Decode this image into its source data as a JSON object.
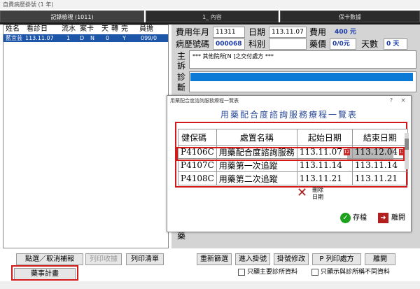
{
  "window": {
    "title": "自費病歷掛號 (1 年)"
  },
  "tabs": [
    {
      "label": "記錄檢視 (1011)"
    },
    {
      "label": "1_ 內容"
    },
    {
      "label": "保卡數據"
    }
  ],
  "left_list": {
    "headers": [
      "姓名",
      "看診日",
      "流水",
      "案卡",
      "天",
      "轉",
      "完",
      "員擔"
    ],
    "selected_row": {
      "name": "藍宜芸",
      "date": "113.11.07",
      "serial": "1",
      "card": "D",
      "case": "N",
      "days": "0",
      "flag": "Y",
      "doc": "099/0"
    }
  },
  "form": {
    "fee_month_label": "費用年月",
    "fee_month": "11311",
    "date_label": "日期",
    "date": "113.11.07",
    "fee_label": "費用",
    "fee_value": "400 元",
    "chart_label": "病歷號碼",
    "chart_no": "000068",
    "dept_label": "科別",
    "drug_price_label": "藥價",
    "drug_price": "0/0元",
    "days_label": "天數",
    "days": "0 天",
    "main_label_1": "主",
    "main_label_2": "訴",
    "main_text": "*** 其他院所[N    ]之交付處方 ***",
    "diag_label_1": "診",
    "diag_label_2": "斷",
    "drug_label": "藥"
  },
  "dialog": {
    "title": "用藥配合度諮詢服務療程一覽表",
    "help": "?",
    "close": "×",
    "heading": "用藥配合度諮詢服務療程一覽表",
    "columns": [
      "健保碼",
      "處置名稱",
      "起始日期",
      "結束日期"
    ],
    "rows": [
      {
        "code": "P4106C",
        "name": "用藥配合度諮詢服務",
        "start": "113.11.07",
        "end": "113.12.04"
      },
      {
        "code": "P4107C",
        "name": "用藥第一次追蹤",
        "start": "113.11.14",
        "end": "113.11.14"
      },
      {
        "code": "P4108C",
        "name": "用藥第二次追蹤",
        "start": "113.11.21",
        "end": "113.11.21"
      }
    ],
    "delete_label_1": "刪除",
    "delete_label_2": "日期",
    "save_label": "存檔",
    "exit_label": "離開"
  },
  "buttons": {
    "toggle_ticket": "點選／取消補報",
    "print_receipt": "列印收據",
    "print_list": "列印清單",
    "drug_plan": "藥事計畫",
    "refilter": "重新篩選",
    "import_lab": "進入掛號",
    "modify_history": "掛號修改",
    "print_rx": "P 列印處方",
    "leave": "離開"
  },
  "checks": {
    "only_main": "只顯主要診所資料",
    "show_diff": "只顯示與診所稱不同資料"
  },
  "colors": {
    "selection": "#1d56a8",
    "highlight_red": "#d21a1a",
    "value_blue": "#1a3aa8"
  }
}
